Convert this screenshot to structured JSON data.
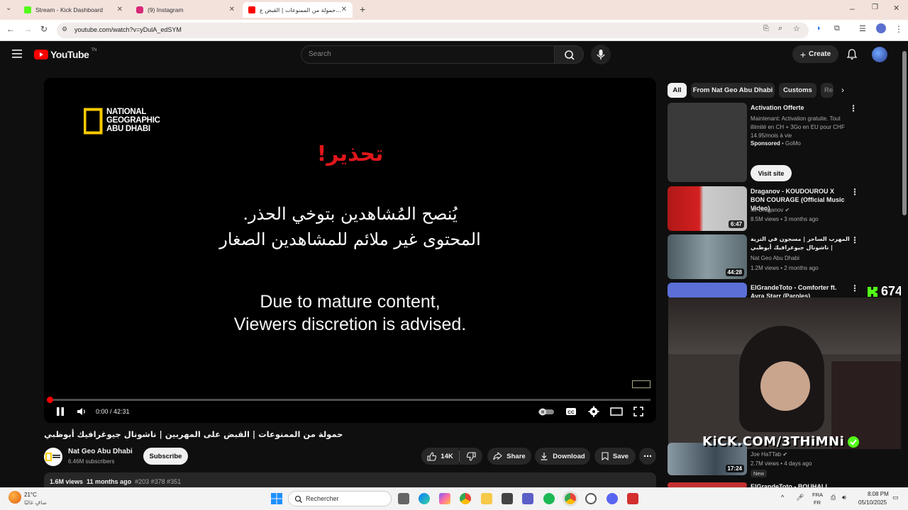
{
  "browser": {
    "tabs": [
      {
        "title": "Stream - Kick Dashboard",
        "color": "#53fc18"
      },
      {
        "title": "(9) Instagram",
        "color": "#d62976"
      },
      {
        "title": "حمولة من الممنوعات | القبض ع...",
        "color": "#ff0000"
      }
    ],
    "url": "youtube.com/watch?v=yDulA_edSYM"
  },
  "header": {
    "logo": "YouTube",
    "logo_sup": "TN",
    "search_placeholder": "Search",
    "create_label": "Create"
  },
  "player": {
    "warning_ar": "تحذير!",
    "advice_ar_1": "يُنصح المُشاهدين بتوخي الحذر.",
    "advice_ar_2": "المحتوى غير ملائم للمشاهدين الصغار",
    "advice_en_1": "Due to mature content,",
    "advice_en_2": "Viewers discretion is advised.",
    "logo_line_1": "NATIONAL",
    "logo_line_2": "GEOGRAPHIC",
    "logo_line_3": "ABU DHABI",
    "time": "0:00 / 42:31",
    "progress": 0.0
  },
  "video": {
    "title": "حمولة من الممنوعات | القبض على المهربين | ناشونال جيوغرافيك أبوظبي",
    "channel": "Nat Geo Abu Dhabi",
    "subscribers": "6.46M subscribers",
    "subscribe_label": "Subscribe",
    "likes": "14K",
    "share_label": "Share",
    "download_label": "Download",
    "save_label": "Save",
    "views": "1.6M views",
    "age": "11 months ago",
    "tags": "#203 #378 #351"
  },
  "sidebar": {
    "chips": [
      "All",
      "From Nat Geo Abu Dhabi",
      "Customs",
      "Re"
    ],
    "ad": {
      "title": "Activation Offerte",
      "desc": "Maintenant: Activation gratuite. Tout illimité en CH + 3Go en EU pour CHF 14.95/mois à vie",
      "sponsored": "Sponsored",
      "advertiser": "GoMo",
      "cta": "Visit site"
    },
    "videos": [
      {
        "title": "Draganov - KOUDOUROU X BON COURAGE (Official Music Video)",
        "channel": "Mr Draganov",
        "meta": "8.5M views • 3 months ago",
        "duration": "6:47"
      },
      {
        "title": "المهرب الساحر | مسجون في الترية | ناشونال جيوغرافيك أبوظبي",
        "channel": "Nat Geo Abu Dhabi",
        "meta": "1.2M views • 2 months ago",
        "duration": "44:28"
      },
      {
        "title": "ElGrandeToto - Comforter ft. Ayra Starr (Paroles)",
        "channel": "",
        "meta": "",
        "duration": ""
      },
      {
        "title": "",
        "channel": "Joe HaTTab",
        "meta": "2.7M views • 4 days ago",
        "duration": "17:24",
        "badge": "New"
      },
      {
        "title": "ElGrandeToto - BOUHALI",
        "channel": "",
        "meta": "",
        "duration": ""
      }
    ]
  },
  "overlay": {
    "viewer_count": "674",
    "kick_url": "KiCK.COM/3THiMNi"
  },
  "taskbar": {
    "weather_temp": "21°C",
    "weather_desc": "صافٍ غالبًا",
    "search_label": "Rechercher",
    "lang_1": "FRA",
    "lang_2": "FR",
    "time": "8:08 PM",
    "date": "05/10/2025"
  }
}
